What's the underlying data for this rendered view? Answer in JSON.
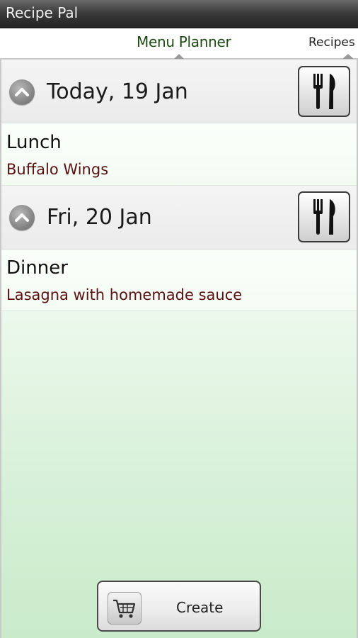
{
  "app": {
    "title": "Recipe Pal"
  },
  "tabs": [
    {
      "label": "Menu Planner",
      "active": true
    },
    {
      "label": "Recipes",
      "active": false
    }
  ],
  "days": [
    {
      "title": "Today, 19 Jan",
      "meals": [
        {
          "type": "Lunch",
          "name": "Buffalo Wings"
        }
      ]
    },
    {
      "title": "Fri, 20 Jan",
      "meals": [
        {
          "type": "Dinner",
          "name": "Lasagna with homemade sauce"
        }
      ]
    }
  ],
  "actions": {
    "create_label": "Create"
  },
  "icons": {
    "collapse": "chevron-up-icon",
    "meal": "cutlery-icon",
    "create": "shopping-cart-icon"
  },
  "colors": {
    "active_tab": "#1d4a13",
    "meal_name": "#5a1111",
    "background_bottom": "#c9ebca"
  }
}
